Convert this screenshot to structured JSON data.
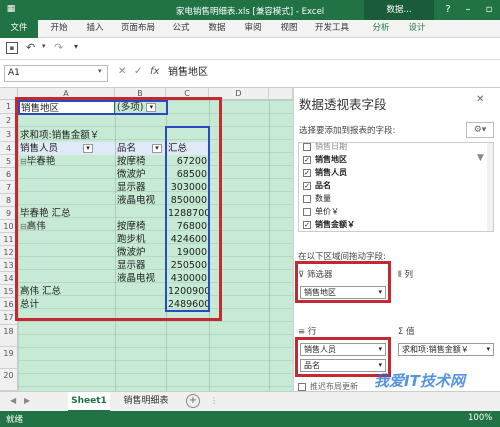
{
  "title": "家电销售明细表.xls  [兼容模式] - Excel",
  "context_tab_group": "数据...",
  "help_label": "?",
  "ribbon_tabs": [
    "文件",
    "开始",
    "插入",
    "页面布局",
    "公式",
    "数据",
    "审阅",
    "视图",
    "开发工具",
    "分析",
    "设计"
  ],
  "name_box": "A1",
  "formula_value": "销售地区",
  "columns": [
    "A",
    "B",
    "C",
    "D"
  ],
  "rows": [
    "1",
    "2",
    "3",
    "4",
    "5",
    "6",
    "7",
    "8",
    "9",
    "10",
    "11",
    "12",
    "13",
    "14",
    "15",
    "16",
    "17",
    "18",
    "19",
    "20"
  ],
  "cells": {
    "a1": "销售地区",
    "b1": "(多项)",
    "a3": "求和项:销售金额￥",
    "a4": "销售人员",
    "b4": "品名",
    "c4": "汇总",
    "a5": "毕春艳",
    "b5": "按摩椅",
    "c5": "67200",
    "b6": "微波炉",
    "c6": "68500",
    "b7": "显示器",
    "c7": "303000",
    "b8": "液晶电视",
    "c8": "850000",
    "a9": "毕春艳 汇总",
    "c9": "1288700",
    "a10": "高伟",
    "b10": "按摩椅",
    "c10": "76800",
    "b11": "跑步机",
    "c11": "424600",
    "b12": "微波炉",
    "c12": "19000",
    "b13": "显示器",
    "c13": "250500",
    "b14": "液晶电视",
    "c14": "430000",
    "a15": "高伟 汇总",
    "c15": "1200900",
    "a16": "总计",
    "c16": "2489600"
  },
  "panel": {
    "title": "数据透视表字段",
    "subtitle": "选择要添加到报表的字段:",
    "fields": [
      {
        "label": "销售日期",
        "checked": false
      },
      {
        "label": "销售地区",
        "checked": true
      },
      {
        "label": "销售人员",
        "checked": true
      },
      {
        "label": "品名",
        "checked": true
      },
      {
        "label": "数量",
        "checked": false
      },
      {
        "label": "单价￥",
        "checked": false
      },
      {
        "label": "销售金额￥",
        "checked": true
      }
    ],
    "drag_hint": "在以下区域间拖动字段:",
    "filter_header": "筛选器",
    "column_header": "列",
    "row_header": "行",
    "value_header": "值",
    "filter_item": "销售地区",
    "row_items": [
      "销售人员",
      "品名"
    ],
    "value_item": "求和项:销售金额￥",
    "defer_label": "推迟布局更新"
  },
  "sheets": [
    "Sheet1",
    "销售明细表"
  ],
  "active_sheet": "Sheet1",
  "status_text": "就绪",
  "zoom": "100%",
  "watermark": "我爱IT技术网"
}
